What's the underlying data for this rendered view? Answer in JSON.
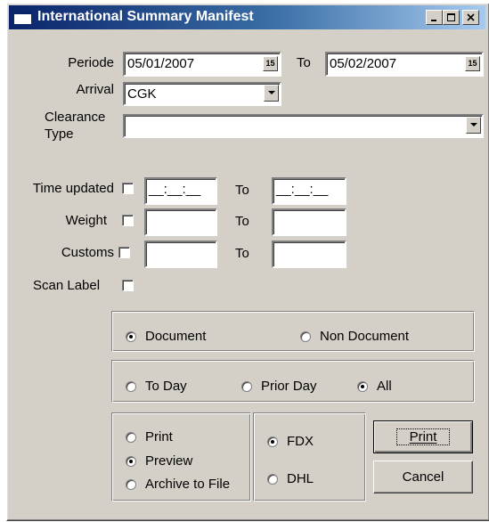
{
  "window": {
    "title": "International Summary Manifest"
  },
  "periode": {
    "label": "Periode",
    "from": "05/01/2007",
    "to_label": "To",
    "to": "05/02/2007",
    "calendar_glyph": "15"
  },
  "arrival": {
    "label": "Arrival",
    "value": "CGK"
  },
  "clearance": {
    "label_line1": "Clearance",
    "label_line2": "Type",
    "value": ""
  },
  "time_updated": {
    "label": "Time updated",
    "from": "__:__:__",
    "to_label": "To",
    "to": "__:__:__"
  },
  "weight": {
    "label": "Weight",
    "from": "",
    "to_label": "To",
    "to": ""
  },
  "customs": {
    "label": "Customs",
    "from": "",
    "to_label": "To",
    "to": ""
  },
  "scan_label": {
    "label": "Scan Label"
  },
  "doc_type": {
    "options": [
      "Document",
      "Non Document"
    ],
    "selected": "Document"
  },
  "day": {
    "options": [
      "To Day",
      "Prior Day",
      "All"
    ],
    "selected": "All"
  },
  "output": {
    "options": [
      "Print",
      "Preview",
      "Archive to File"
    ],
    "selected": "Preview"
  },
  "carrier": {
    "options": [
      "FDX",
      "DHL"
    ],
    "selected": "FDX"
  },
  "buttons": {
    "print": "Print",
    "cancel": "Cancel"
  },
  "icons": {
    "title": "window-icon",
    "minimize": "minimize-icon",
    "maximize": "maximize-icon",
    "close": "close-icon"
  }
}
